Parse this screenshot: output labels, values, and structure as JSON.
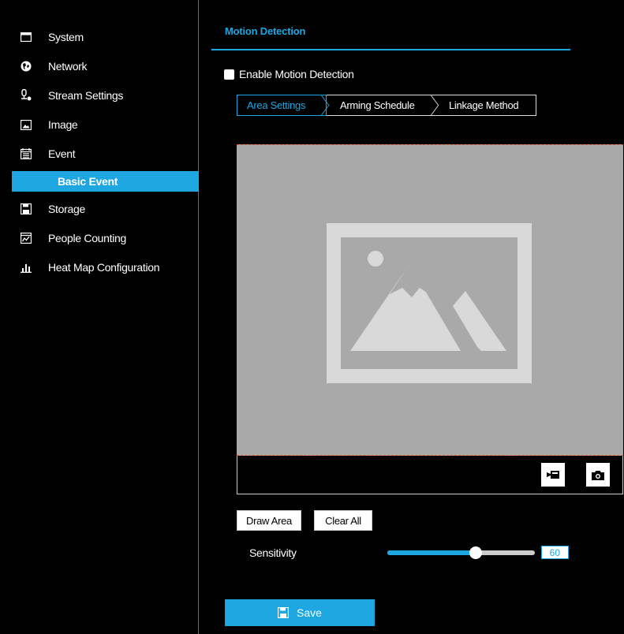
{
  "sidebar": {
    "items": [
      {
        "label": "System",
        "icon": "window-icon"
      },
      {
        "label": "Network",
        "icon": "globe-icon"
      },
      {
        "label": "Stream Settings",
        "icon": "camera-stream-icon"
      },
      {
        "label": "Image",
        "icon": "image-icon"
      },
      {
        "label": "Event",
        "icon": "calendar-icon"
      },
      {
        "label": "Basic Event",
        "icon": ""
      },
      {
        "label": "Storage",
        "icon": "floppy-icon"
      },
      {
        "label": "People Counting",
        "icon": "people-counting-icon"
      },
      {
        "label": "Heat Map Configuration",
        "icon": "bar-chart-icon"
      }
    ],
    "active_index": 5
  },
  "main": {
    "tab_title": "Motion Detection",
    "enable_label": "Enable Motion Detection",
    "enable_checked": false,
    "subtabs": [
      {
        "label": "Area Settings",
        "active": true
      },
      {
        "label": "Arming Schedule",
        "active": false
      },
      {
        "label": "Linkage Method",
        "active": false
      }
    ],
    "buttons": {
      "draw_area": "Draw Area",
      "clear_all": "Clear All"
    },
    "sensitivity": {
      "label": "Sensitivity",
      "value": "60",
      "fraction": 0.6
    },
    "save_label": "Save"
  },
  "colors": {
    "accent": "#1ea6e0",
    "preview_bg": "#a9a9a9",
    "area_border": "#e05c2a"
  }
}
